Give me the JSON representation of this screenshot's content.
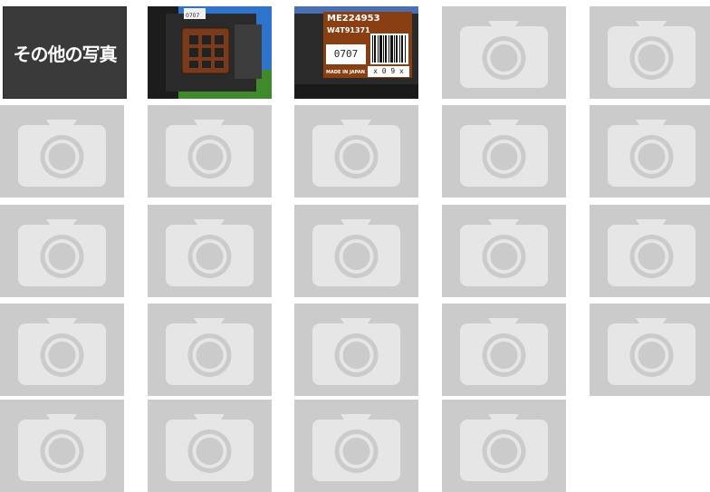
{
  "other_photos_label": "その他の写真",
  "photo1": {
    "label_text": "0707"
  },
  "photo2": {
    "part_number": "ME224953",
    "serial": "W4T91371",
    "code": "0707",
    "made_in": "MADE IN JAPAN",
    "lot": "x 0 9 x"
  },
  "placeholder_icon": "camera-icon",
  "colors": {
    "placeholder_bg": "#cbcbcb",
    "placeholder_icon": "#e6e6e6",
    "label_bg": "#8a3f12",
    "dark_tile": "#3a3a3a"
  }
}
